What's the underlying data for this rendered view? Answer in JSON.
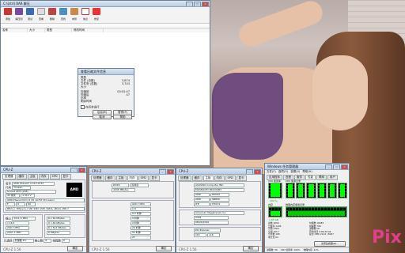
{
  "winrar": {
    "title": "C:\\(ctrl) RAR 解压",
    "toolbar": [
      "添加",
      "解压到",
      "测试",
      "查看",
      "删除",
      "查找",
      "向导",
      "信息",
      "修复"
    ],
    "columns": [
      "名称",
      "大小",
      "类型",
      "修改时间"
    ],
    "dialog": {
      "title": "查看压缩文件信息",
      "rows": [
        {
          "label": "类型",
          "value": ""
        },
        {
          "label": "文件 (总数)",
          "value": "3,874"
        },
        {
          "label": "文件夹 (总数)",
          "value": "3,743"
        },
        {
          "label": "大小",
          "value": ""
        },
        {
          "label": "压缩前",
          "value": "00:02:47"
        },
        {
          "label": "压缩后",
          "value": "47"
        },
        {
          "label": "比率",
          "value": ""
        },
        {
          "label": "剩余时间",
          "value": ""
        }
      ],
      "checkbox": "在后台运行",
      "buttons": [
        "后台(B)",
        "暂停(P)",
        "取消",
        "帮助"
      ]
    }
  },
  "cpuz1": {
    "title": "CPU-Z",
    "tabs": [
      "处理器",
      "缓存",
      "主板",
      "内存",
      "SPD",
      "显卡",
      "关于"
    ],
    "name_label": "名字",
    "name_value": "AMD Phenom II X6 1075T",
    "code_label": "代号",
    "code_value": "Thuban",
    "spec_value": "AMD Phenom(tm) II X6 1075T Processor",
    "core_label": "核心",
    "core_value": "3.3GHz",
    "chip_text": "AMD",
    "footer": "CPU-Z 1.56",
    "rows": [
      "AMD Phenom II X6 1075T",
      "Thuban",
      "Socket AM3 (938)",
      "45 纳米",
      "1.312 V",
      "F",
      "0",
      "E0",
      "MMX(+), 3DNow!(+), SSE, SSE2, SSE3, SSE4A, x86-64, AMD-V"
    ],
    "clock_rows": [
      "3311.5 MHz",
      "x 16.5",
      "200.7 MHz",
      "2007.1 MHz"
    ],
    "cache_rows": [
      "6 x 64 KBytes",
      "6 x 64 KBytes",
      "6 x 512 KBytes",
      "6 MBytes"
    ],
    "selection_label": "已选择",
    "selection_value": "处理器 #1",
    "cores_label": "核心数",
    "cores_value": "6",
    "threads_label": "线程数",
    "threads_value": "6",
    "button": "确定"
  },
  "cpuz2": {
    "title": "CPU-Z",
    "tabs": [
      "处理器",
      "缓存",
      "主板",
      "内存",
      "SPD",
      "显卡",
      "关于"
    ],
    "rows": [
      "DDR3",
      "双通道",
      "4096 MBytes",
      "",
      "",
      "900.7 MHz",
      "1:9",
      "9.0 时钟",
      "9 时钟",
      "9 时钟",
      "24 时钟",
      "33 时钟",
      "",
      "2T"
    ],
    "footer": "CPU-Z 1.56",
    "button": "确定"
  },
  "cpuz3": {
    "title": "CPU-Z",
    "tabs": [
      "处理器",
      "缓存",
      "主板",
      "内存",
      "SPD",
      "显卡",
      "关于"
    ],
    "rows": [
      "ASUSTeK Computer INC.",
      "M4A89GTD PRO/USB3",
      "AMD",
      "890GX",
      "AMD",
      "SB850",
      "ITE",
      "IT8721"
    ],
    "bios_rows": [
      "American Megatrends Inc.",
      "0401",
      "08/24/2010"
    ],
    "gfx_rows": [
      "PCI-Express",
      "x16",
      "x16"
    ],
    "footer": "CPU-Z 1.56",
    "button": "确定"
  },
  "taskmgr": {
    "title": "Windows 任务管理器",
    "menu": [
      "文件(F)",
      "选项(O)",
      "查看(V)",
      "帮助(H)"
    ],
    "tabs": [
      "应用程序",
      "进程",
      "服务",
      "性能",
      "联网",
      "用户"
    ],
    "cpu_label": "CPU 使用率",
    "cpu_value": "100 %",
    "history_label": "CPU 使用记录",
    "mem_label": "内存",
    "mem_value": "1.65 GB",
    "mem_history_label": "物理内存使用记录",
    "stats": [
      [
        "总数",
        "4094"
      ],
      [
        "已缓存",
        "1436"
      ],
      [
        "可用",
        "2360"
      ],
      [
        "空闲",
        "1017"
      ],
      [
        "句柄数",
        "16583"
      ],
      [
        "线程数",
        "706"
      ],
      [
        "进程数",
        "56"
      ],
      [
        "开机时间",
        "0:00:20:44"
      ],
      [
        "提交 (MB)",
        "2124 / 8187"
      ]
    ],
    "kernel": [
      [
        "分页数",
        "168"
      ],
      [
        "未分页",
        "62"
      ]
    ],
    "resource_button": "资源监视器(R)...",
    "status": [
      "进程数: 56",
      "CPU 使用率: 100%",
      "物理内存: 41%"
    ]
  },
  "wallpaper_text": "Pix",
  "colors": {
    "accent_green": "#00ff00",
    "rar_red": "#c33",
    "cpuz_blue": "#3a5fa0"
  }
}
